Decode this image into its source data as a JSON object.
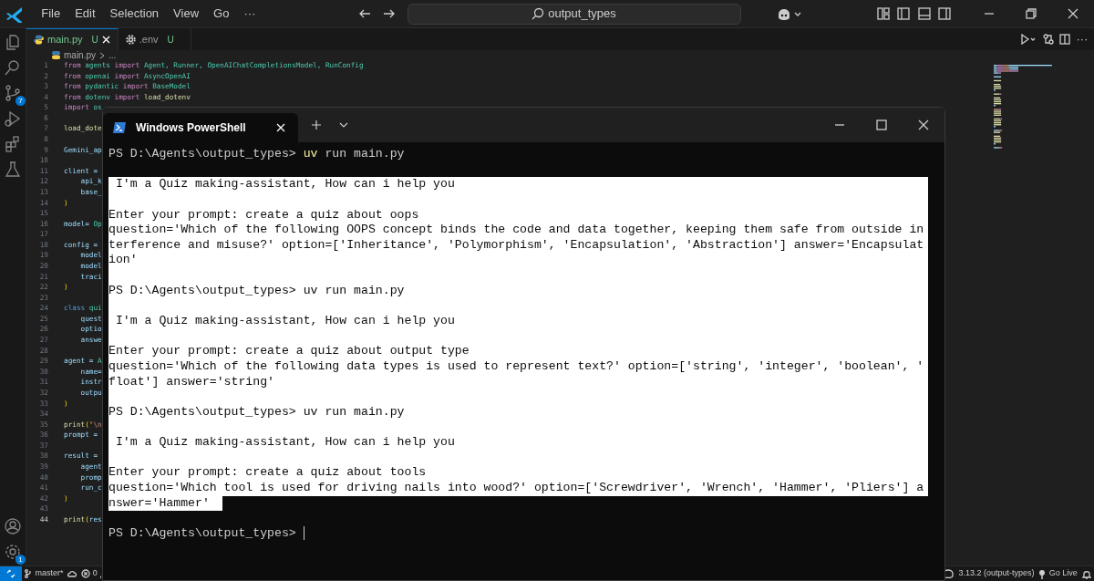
{
  "title_bar": {
    "menu": [
      "File",
      "Edit",
      "Selection",
      "View",
      "Go",
      "···"
    ],
    "search": "output_types"
  },
  "activity_badges": {
    "source_control": "7",
    "settings": "1"
  },
  "tabs": [
    {
      "label": "main.py",
      "status": "U",
      "kind": "python",
      "selected": true
    },
    {
      "label": ".env",
      "status": "U",
      "kind": "config",
      "selected": false
    }
  ],
  "editor_actions": {
    "more": "···"
  },
  "breadcrumb": {
    "file": "main.py",
    "more": "..."
  },
  "editor": {
    "lines": [
      {
        "number": "1",
        "current": false,
        "tokens": [
          {
            "text": "from",
            "kind": "kw"
          },
          {
            "text": " agents ",
            "kind": "type"
          },
          {
            "text": "import",
            "kind": "kw"
          },
          {
            "text": " Agent, Runner, OpenAIChatCompletionsModel, RunConfig",
            "kind": "type"
          }
        ]
      },
      {
        "number": "2",
        "current": false,
        "tokens": [
          {
            "text": "from",
            "kind": "kw"
          },
          {
            "text": " openai ",
            "kind": "type"
          },
          {
            "text": "import",
            "kind": "kw"
          },
          {
            "text": " AsyncOpenAI",
            "kind": "type"
          }
        ]
      },
      {
        "number": "3",
        "current": false,
        "tokens": [
          {
            "text": "from",
            "kind": "kw"
          },
          {
            "text": " pydantic ",
            "kind": "type"
          },
          {
            "text": "import",
            "kind": "kw"
          },
          {
            "text": " BaseModel",
            "kind": "type"
          }
        ]
      },
      {
        "number": "4",
        "current": false,
        "tokens": [
          {
            "text": "from",
            "kind": "kw"
          },
          {
            "text": " dotenv ",
            "kind": "type"
          },
          {
            "text": "import",
            "kind": "kw"
          },
          {
            "text": " load_dotenv",
            "kind": "fn"
          }
        ]
      },
      {
        "number": "5",
        "current": false,
        "tokens": [
          {
            "text": "import",
            "kind": "kw"
          },
          {
            "text": " os",
            "kind": "type"
          }
        ]
      },
      {
        "number": "6",
        "current": false
      },
      {
        "number": "7",
        "current": false,
        "tokens": [
          {
            "text": "load_dote",
            "kind": "fn"
          }
        ]
      },
      {
        "number": "8",
        "current": false
      },
      {
        "number": "9",
        "current": false,
        "tokens": [
          {
            "text": "Gemini_ap",
            "kind": "var"
          }
        ]
      },
      {
        "number": "10",
        "current": false
      },
      {
        "number": "11",
        "current": false,
        "tokens": [
          {
            "text": "client =",
            "kind": "var"
          }
        ]
      },
      {
        "number": "12",
        "current": false,
        "tokens": [
          {
            "text": "    api_k",
            "kind": "var"
          }
        ]
      },
      {
        "number": "13",
        "current": false,
        "tokens": [
          {
            "text": "    base_",
            "kind": "var"
          }
        ]
      },
      {
        "number": "14",
        "current": false,
        "tokens": [
          {
            "text": ")",
            "kind": "bracket"
          }
        ]
      },
      {
        "number": "15",
        "current": false
      },
      {
        "number": "16",
        "current": false,
        "tokens": [
          {
            "text": "model= ",
            "kind": "var"
          },
          {
            "text": "Op",
            "kind": "type"
          }
        ]
      },
      {
        "number": "17",
        "current": false
      },
      {
        "number": "18",
        "current": false,
        "tokens": [
          {
            "text": "config =",
            "kind": "var"
          }
        ]
      },
      {
        "number": "19",
        "current": false,
        "tokens": [
          {
            "text": "    model",
            "kind": "var"
          }
        ]
      },
      {
        "number": "20",
        "current": false,
        "tokens": [
          {
            "text": "    model",
            "kind": "var"
          }
        ]
      },
      {
        "number": "21",
        "current": false,
        "tokens": [
          {
            "text": "    traci",
            "kind": "var"
          }
        ]
      },
      {
        "number": "22",
        "current": false,
        "tokens": [
          {
            "text": ")",
            "kind": "bracket"
          }
        ]
      },
      {
        "number": "23",
        "current": false
      },
      {
        "number": "24",
        "current": false,
        "tokens": [
          {
            "text": "class ",
            "kind": "decl"
          },
          {
            "text": "qui",
            "kind": "type"
          }
        ]
      },
      {
        "number": "25",
        "current": false,
        "tokens": [
          {
            "text": "    quest",
            "kind": "var"
          }
        ]
      },
      {
        "number": "26",
        "current": false,
        "tokens": [
          {
            "text": "    optio",
            "kind": "var"
          }
        ]
      },
      {
        "number": "27",
        "current": false,
        "tokens": [
          {
            "text": "    answe",
            "kind": "var"
          }
        ]
      },
      {
        "number": "28",
        "current": false
      },
      {
        "number": "29",
        "current": false,
        "tokens": [
          {
            "text": "agent = ",
            "kind": "var"
          },
          {
            "text": "A",
            "kind": "type"
          }
        ]
      },
      {
        "number": "30",
        "current": false,
        "tokens": [
          {
            "text": "    name=",
            "kind": "var"
          }
        ]
      },
      {
        "number": "31",
        "current": false,
        "tokens": [
          {
            "text": "    instr",
            "kind": "var"
          }
        ]
      },
      {
        "number": "32",
        "current": false,
        "tokens": [
          {
            "text": "    outpu",
            "kind": "var"
          }
        ]
      },
      {
        "number": "33",
        "current": false,
        "tokens": [
          {
            "text": ")",
            "kind": "bracket"
          }
        ]
      },
      {
        "number": "34",
        "current": false
      },
      {
        "number": "35",
        "current": false,
        "tokens": [
          {
            "text": "print",
            "kind": "fn"
          },
          {
            "text": "(",
            "kind": "bracket"
          },
          {
            "text": "\"\\n",
            "kind": "str"
          }
        ]
      },
      {
        "number": "36",
        "current": false,
        "tokens": [
          {
            "text": "prompt =",
            "kind": "var"
          }
        ]
      },
      {
        "number": "37",
        "current": false
      },
      {
        "number": "38",
        "current": false,
        "tokens": [
          {
            "text": "result =",
            "kind": "var"
          }
        ]
      },
      {
        "number": "39",
        "current": false,
        "tokens": [
          {
            "text": "    agent",
            "kind": "var"
          }
        ]
      },
      {
        "number": "40",
        "current": false,
        "tokens": [
          {
            "text": "    promp",
            "kind": "var"
          }
        ]
      },
      {
        "number": "41",
        "current": false,
        "tokens": [
          {
            "text": "    run_c",
            "kind": "var"
          }
        ]
      },
      {
        "number": "42",
        "current": false,
        "tokens": [
          {
            "text": ")",
            "kind": "bracket"
          }
        ]
      },
      {
        "number": "43",
        "current": false
      },
      {
        "number": "44",
        "current": true,
        "tokens": [
          {
            "text": "print",
            "kind": "fn"
          },
          {
            "text": "(",
            "kind": "bracket"
          },
          {
            "text": "res",
            "kind": "var"
          }
        ]
      }
    ]
  },
  "terminal": {
    "tab": "Windows PowerShell",
    "lines": [
      {
        "kind": "prompt",
        "highlight": false,
        "prompt": "PS D:\\Agents\\output_types>",
        "command": "uv",
        "args": "run main.py"
      },
      {
        "kind": "blank",
        "highlight": false
      },
      {
        "kind": "text",
        "highlight": true,
        "text": " I'm a Quiz making-assistant, How can i help you"
      },
      {
        "kind": "blank",
        "highlight": true
      },
      {
        "kind": "text",
        "highlight": true,
        "text": "Enter your prompt: create a quiz about oops"
      },
      {
        "kind": "text",
        "highlight": true,
        "text": "question='Which of the following OOPS concept binds the code and data together, keeping them safe from outside in"
      },
      {
        "kind": "text",
        "highlight": true,
        "text": "terference and misuse?' option=['Inheritance', 'Polymorphism', 'Encapsulation', 'Abstraction'] answer='Encapsulat"
      },
      {
        "kind": "text",
        "highlight": true,
        "text": "ion'"
      },
      {
        "kind": "blank",
        "highlight": true
      },
      {
        "kind": "prompt",
        "highlight": true,
        "prompt": "PS D:\\Agents\\output_types>",
        "command": "uv",
        "args": "run main.py"
      },
      {
        "kind": "blank",
        "highlight": true
      },
      {
        "kind": "text",
        "highlight": true,
        "text": " I'm a Quiz making-assistant, How can i help you"
      },
      {
        "kind": "blank",
        "highlight": true
      },
      {
        "kind": "text",
        "highlight": true,
        "text": "Enter your prompt: create a quiz about output type"
      },
      {
        "kind": "text",
        "highlight": true,
        "text": "question='Which of the following data types is used to represent text?' option=['string', 'integer', 'boolean', '"
      },
      {
        "kind": "text",
        "highlight": true,
        "text": "float'] answer='string'"
      },
      {
        "kind": "blank",
        "highlight": true
      },
      {
        "kind": "prompt",
        "highlight": true,
        "prompt": "PS D:\\Agents\\output_types>",
        "command": "uv",
        "args": "run main.py"
      },
      {
        "kind": "blank",
        "highlight": true
      },
      {
        "kind": "text",
        "highlight": true,
        "text": " I'm a Quiz making-assistant, How can i help you"
      },
      {
        "kind": "blank",
        "highlight": true
      },
      {
        "kind": "text",
        "highlight": true,
        "text": "Enter your prompt: create a quiz about tools"
      },
      {
        "kind": "text",
        "highlight": true,
        "text": "question='Which tool is used for driving nails into wood?' option=['Screwdriver', 'Wrench', 'Hammer', 'Pliers'] a"
      },
      {
        "kind": "text",
        "highlight": true,
        "cut": true,
        "text": "nswer='Hammer'"
      },
      {
        "kind": "blank",
        "highlight": false
      },
      {
        "kind": "prompt",
        "highlight": false,
        "prompt": "PS D:\\Agents\\output_types>",
        "cursor": true
      }
    ]
  },
  "status_bar": {
    "branch": "master*",
    "errors": "0",
    "interpreter": "3.13.2 (output-types)",
    "live": "Go Live"
  }
}
